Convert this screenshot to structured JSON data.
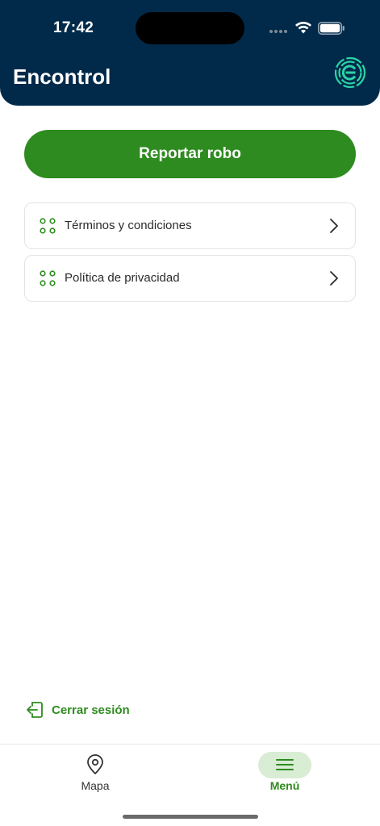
{
  "status_bar": {
    "time": "17:42"
  },
  "header": {
    "title": "Encontrol",
    "logo_icon": "encontrol-logo-icon"
  },
  "actions": {
    "report_label": "Reportar robo"
  },
  "menu_items": [
    {
      "label": "Términos y condiciones",
      "icon": "dots-grid-icon"
    },
    {
      "label": "Política de privacidad",
      "icon": "dots-grid-icon"
    }
  ],
  "logout": {
    "label": "Cerrar sesión"
  },
  "tabbar": {
    "tabs": [
      {
        "label": "Mapa",
        "icon": "map-pin-icon",
        "selected": false
      },
      {
        "label": "Menú",
        "icon": "menu-icon",
        "selected": true
      }
    ]
  },
  "colors": {
    "header_bg": "#012a4a",
    "accent_green": "#2e8b1f",
    "pill_bg": "#d9ecd4",
    "logo_teal": "#2bd4a6"
  }
}
